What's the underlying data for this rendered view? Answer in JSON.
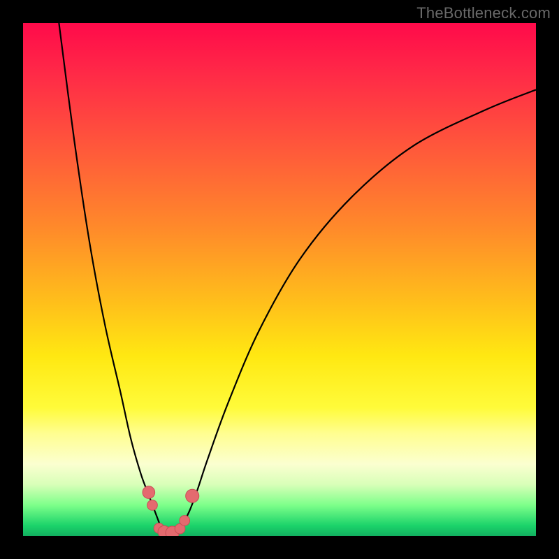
{
  "watermark": "TheBottleneck.com",
  "colors": {
    "frame": "#000000",
    "curve": "#000000",
    "marker_fill": "#e46a6f",
    "marker_stroke": "#c94e57"
  },
  "chart_data": {
    "type": "line",
    "title": "",
    "xlabel": "",
    "ylabel": "",
    "xlim": [
      0,
      100
    ],
    "ylim": [
      0,
      100
    ],
    "grid": false,
    "series": [
      {
        "name": "left-curve",
        "x": [
          7,
          10,
          13,
          16,
          19,
          21,
          23,
          24.5,
          26,
          27,
          28
        ],
        "values": [
          100,
          77,
          57,
          41,
          28,
          19,
          12,
          8,
          4,
          1.5,
          0
        ]
      },
      {
        "name": "right-curve",
        "x": [
          30,
          31,
          32.5,
          34,
          36,
          40,
          46,
          54,
          64,
          76,
          90,
          100
        ],
        "values": [
          0,
          2,
          5,
          9,
          15,
          26,
          40,
          54,
          66,
          76,
          83,
          87
        ]
      }
    ],
    "markers": [
      {
        "x": 24.5,
        "y": 8.5,
        "r": 1.2
      },
      {
        "x": 25.2,
        "y": 6.0,
        "r": 1.0
      },
      {
        "x": 26.5,
        "y": 1.5,
        "r": 1.0
      },
      {
        "x": 27.5,
        "y": 0.8,
        "r": 1.2
      },
      {
        "x": 29.1,
        "y": 0.6,
        "r": 1.3
      },
      {
        "x": 30.6,
        "y": 1.4,
        "r": 1.0
      },
      {
        "x": 31.5,
        "y": 3.0,
        "r": 1.0
      },
      {
        "x": 33.0,
        "y": 7.8,
        "r": 1.3
      }
    ]
  }
}
